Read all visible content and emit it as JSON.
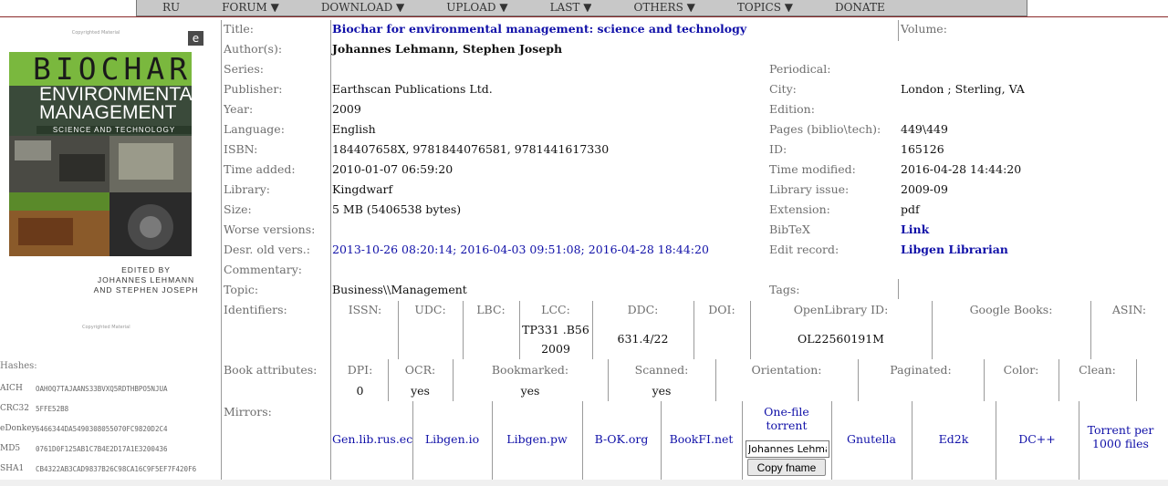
{
  "topmenu": [
    "RU",
    "FORUM ▼",
    "DOWNLOAD ▼",
    "UPLOAD ▼",
    "LAST ▼",
    "OTHERS ▼",
    "TOPICS ▼",
    "DONATE"
  ],
  "cover": {
    "copyright": "Copyrighted Material",
    "logo": "e",
    "title1": "BIOCHAR",
    "title2": "ENVIRONMENTAL",
    "title3": "MANAGEMENT",
    "subtitle": "SCIENCE AND TECHNOLOGY",
    "editors1": "EDITED BY",
    "editors2": "JOHANNES LEHMANN",
    "editors3": "AND STEPHEN JOSEPH",
    "colors": {
      "green": "#7ab83e",
      "dark": "#3a4a3a"
    }
  },
  "hashes": {
    "heading": "Hashes:",
    "items": [
      {
        "key": "AICH",
        "value": "OAHOQ7TAJAANS33BVXQ5RDTHBPO5NJUA"
      },
      {
        "key": "CRC32",
        "value": "5FFE52B8"
      },
      {
        "key": "eDonkey",
        "value": "6466344DA5490308055070FC9820D2C4"
      },
      {
        "key": "MD5",
        "value": "0761D0F125AB1C7B4E2D17A1E3200436"
      },
      {
        "key": "SHA1",
        "value": "CB4322AB3CAD9837B26C98CA16C9F5EF7F420F6"
      }
    ]
  },
  "labels": {
    "title": "Title:",
    "authors": "Author(s):",
    "series": "Series:",
    "publisher": "Publisher:",
    "year": "Year:",
    "language": "Language:",
    "isbn": "ISBN:",
    "time_added": "Time added:",
    "library": "Library:",
    "size": "Size:",
    "worse": "Worse versions:",
    "desr": "Desr. old vers.:",
    "commentary": "Commentary:",
    "topic": "Topic:",
    "identifiers": "Identifiers:",
    "attributes": "Book attributes:",
    "mirrors": "Mirrors:",
    "volume": "Volume:",
    "periodical": "Periodical:",
    "city": "City:",
    "edition": "Edition:",
    "pages": "Pages (biblio\\tech):",
    "id": "ID:",
    "time_modified": "Time modified:",
    "library_issue": "Library issue:",
    "extension": "Extension:",
    "bibtex": "BibTeX",
    "edit_record": "Edit record:",
    "tags": "Tags:"
  },
  "book": {
    "title": "Biochar for environmental management: science and technology",
    "authors": "Johannes Lehmann, Stephen Joseph",
    "publisher": "Earthscan Publications Ltd.",
    "year": "2009",
    "language": "English",
    "isbn": "184407658X, 9781844076581, 9781441617330",
    "time_added": "2010-01-07 06:59:20",
    "library": "Kingdwarf",
    "size": "5 MB (5406538 bytes)",
    "desr": "2013-10-26 08:20:14; 2016-04-03 09:51:08; 2016-04-28 18:44:20",
    "topic": "Business\\\\Management",
    "city": "London ; Sterling, VA",
    "pages": "449\\449",
    "id": "165126",
    "time_modified": "2016-04-28 14:44:20",
    "library_issue": "2009-09",
    "extension": "pdf",
    "bibtex": "Link",
    "edit_record": "Libgen Librarian"
  },
  "identifiers": {
    "headers": {
      "issn": "ISSN:",
      "udc": "UDC:",
      "lbc": "LBC:",
      "lcc": "LCC:",
      "ddc": "DDC:",
      "doi": "DOI:",
      "openlibrary": "OpenLibrary ID:",
      "google": "Google Books:",
      "asin": "ASIN:"
    },
    "lcc1": "TP331 .B56",
    "lcc2": "2009",
    "ddc": "631.4/22",
    "openlibrary": "OL22560191M"
  },
  "attributes": {
    "headers": {
      "dpi": "DPI:",
      "ocr": "OCR:",
      "bookmarked": "Bookmarked:",
      "scanned": "Scanned:",
      "orientation": "Orientation:",
      "paginated": "Paginated:",
      "color": "Color:",
      "clean": "Clean:"
    },
    "dpi": "0",
    "ocr": "yes",
    "bookmarked": "yes",
    "scanned": "yes"
  },
  "mirrors": {
    "genlib": "Gen.lib.rus.ec",
    "libgenio": "Libgen.io",
    "libgenpw": "Libgen.pw",
    "bok": "B-OK.org",
    "bookfi": "BookFI.net",
    "torrent1": "One-file",
    "torrent2": "torrent",
    "fname_value": "Johannes Lehmann, Stephen Joseph",
    "copy_fname": "Copy fname",
    "gnutella": "Gnutella",
    "ed2k": "Ed2k",
    "dcpp": "DC++",
    "torrent_per1": "Torrent per",
    "torrent_per2": "1000 files"
  }
}
